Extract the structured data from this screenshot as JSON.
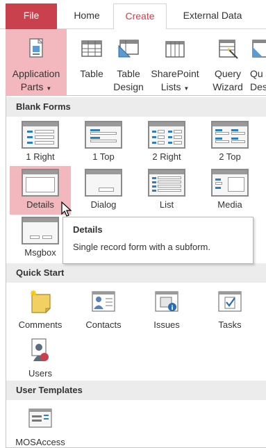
{
  "tabs": {
    "file": "File",
    "home": "Home",
    "create": "Create",
    "external": "External Data"
  },
  "ribbon": {
    "app_parts": {
      "line1": "Application",
      "line2": "Parts",
      "icon": "application-parts-icon"
    },
    "table": {
      "line1": "Table",
      "line2": "",
      "icon": "table-icon"
    },
    "table_design": {
      "line1": "Table",
      "line2": "Design",
      "icon": "table-design-icon"
    },
    "sharepoint": {
      "line1": "SharePoint",
      "line2": "Lists",
      "icon": "sharepoint-lists-icon"
    },
    "query_wizard": {
      "line1": "Query",
      "line2": "Wizard",
      "icon": "query-wizard-icon"
    },
    "query_design": {
      "line1": "Qu",
      "line2": "Des",
      "icon": "query-design-icon"
    }
  },
  "sections": {
    "blank_forms": "Blank Forms",
    "quick_start": "Quick Start",
    "user_templates": "User Templates"
  },
  "blank_forms": [
    "1 Right",
    "1 Top",
    "2 Right",
    "2 Top",
    "Details",
    "Dialog",
    "List",
    "Media",
    "Msgbox"
  ],
  "quick_start": [
    "Comments",
    "Contacts",
    "Issues",
    "Tasks",
    "Users"
  ],
  "user_templates": [
    "MOSAccess"
  ],
  "tooltip": {
    "title": "Details",
    "description": "Single record form with a subform."
  },
  "colors": {
    "accent": "#c8414d",
    "highlight": "#f3b8bd",
    "section_bg": "#ececec"
  }
}
